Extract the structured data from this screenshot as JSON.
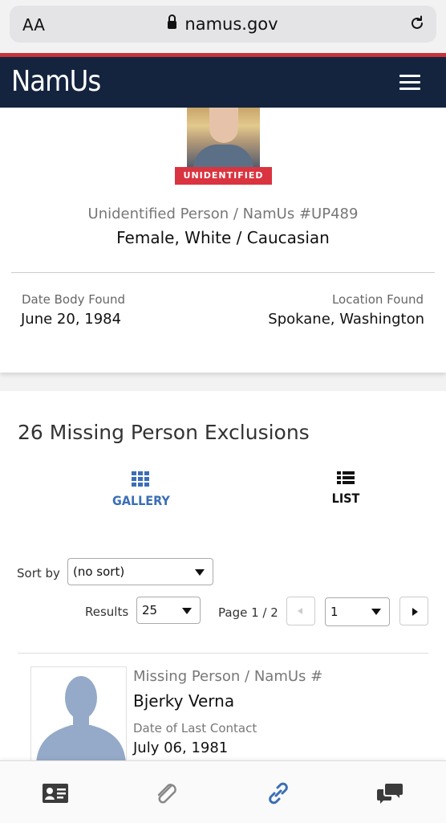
{
  "browser": {
    "text_size_label": "AA",
    "url": "namus.gov"
  },
  "header": {
    "brand": "NamUs"
  },
  "case": {
    "status_badge": "UNIDENTIFIED",
    "case_id": "Unidentified Person / NamUs #UP489",
    "description": "Female, White / Caucasian",
    "date_found_label": "Date Body Found",
    "date_found": "June 20, 1984",
    "location_label": "Location Found",
    "location": "Spokane, Washington"
  },
  "exclusions": {
    "title": "26 Missing Person Exclusions",
    "tabs": [
      {
        "label": "GALLERY",
        "icon": "grid-icon",
        "active": true
      },
      {
        "label": "LIST",
        "icon": "list-icon",
        "active": false
      }
    ],
    "sort_label": "Sort by",
    "sort_value": "(no sort)",
    "results_label": "Results",
    "results_value": "25",
    "page_label": "Page 1 / 2",
    "page_value": "1",
    "items": [
      {
        "type": "Missing Person / NamUs #",
        "name": "Bjerky Verna",
        "date_label": "Date of Last Contact",
        "date": "July 06, 1981"
      }
    ]
  },
  "bottom_nav": [
    {
      "icon": "id-card-icon"
    },
    {
      "icon": "paperclip-icon"
    },
    {
      "icon": "link-icon"
    },
    {
      "icon": "chat-bubbles-icon"
    }
  ],
  "colors": {
    "header_bg": "#14243f",
    "accent_red": "#d9343f",
    "link_blue": "#3a6fb5"
  }
}
